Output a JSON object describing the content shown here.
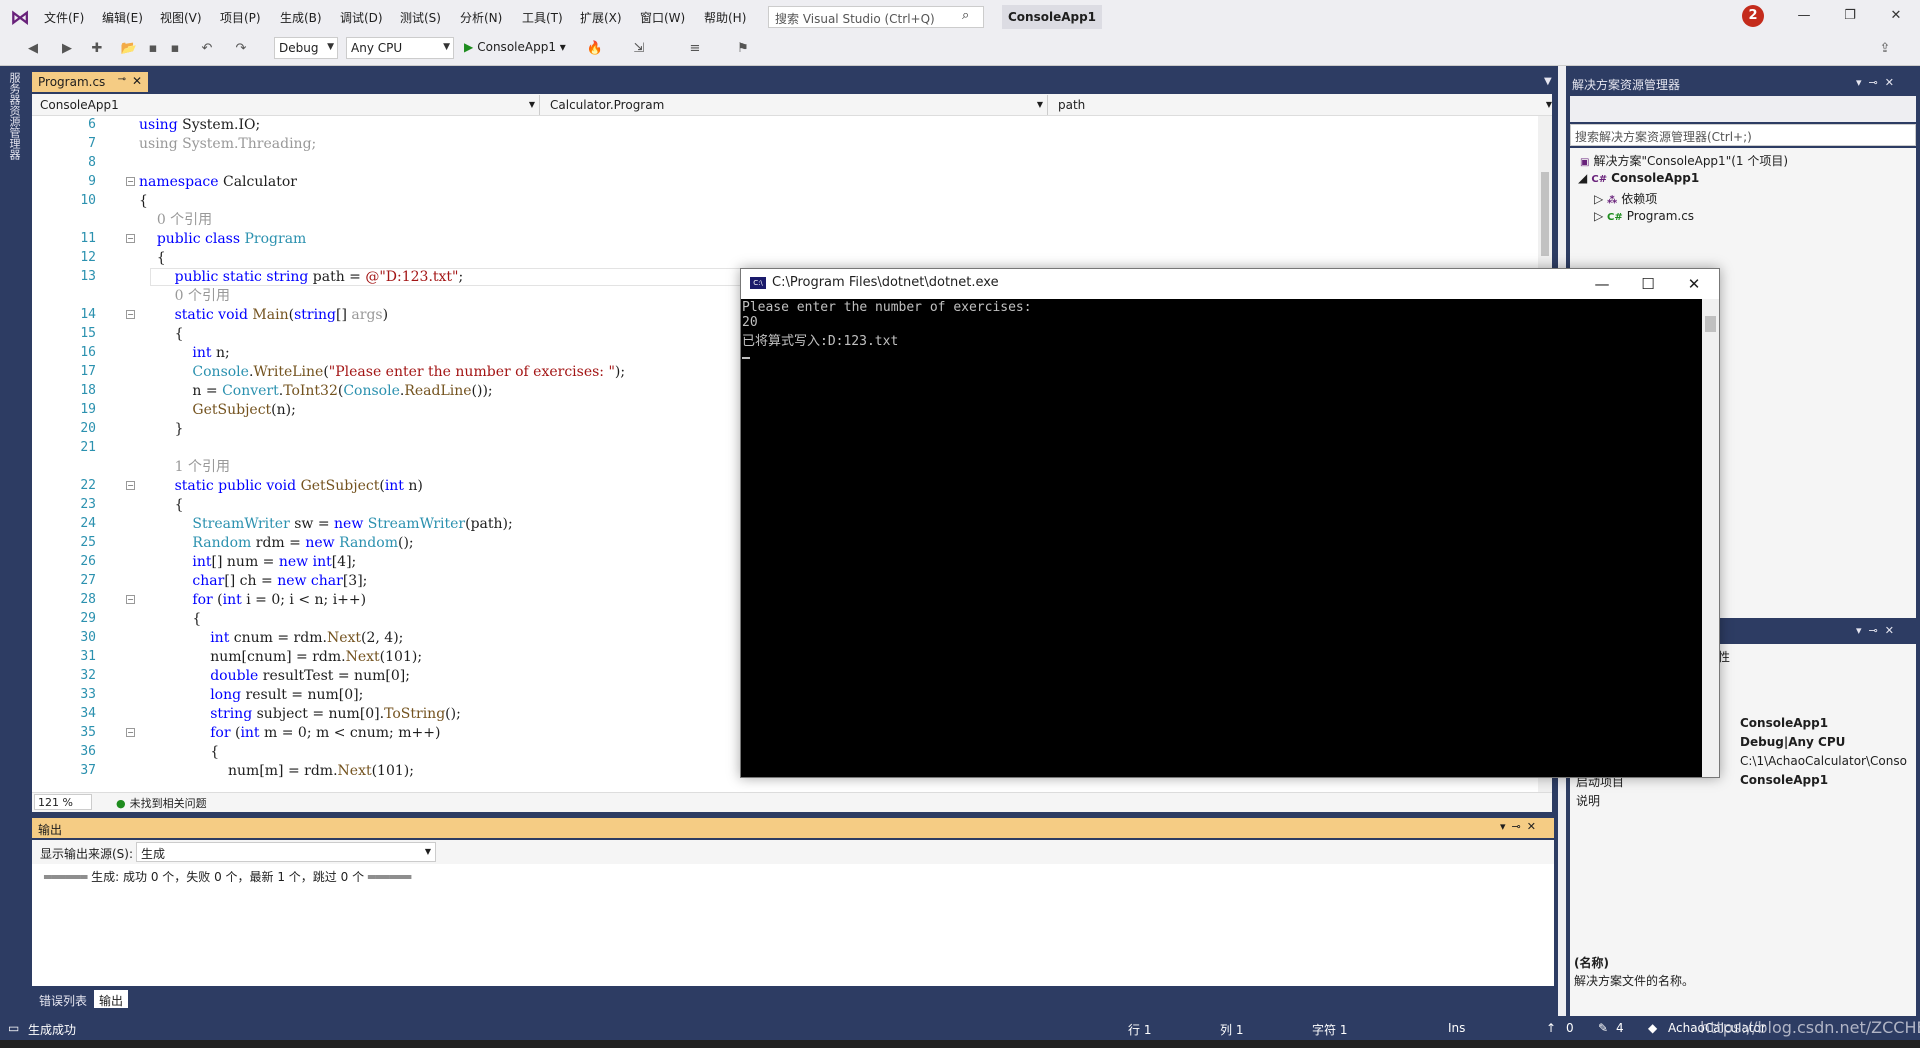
{
  "menu": [
    "文件(F)",
    "编辑(E)",
    "视图(V)",
    "项目(P)",
    "生成(B)",
    "调试(D)",
    "测试(S)",
    "分析(N)",
    "工具(T)",
    "扩展(X)",
    "窗口(W)",
    "帮助(H)"
  ],
  "search": {
    "placeholder": "搜索 Visual Studio (Ctrl+Q)"
  },
  "solution_title": "ConsoleApp1",
  "notification_count": "2",
  "toolbar": {
    "config": "Debug",
    "platform": "Any CPU",
    "start_label": "ConsoleApp1"
  },
  "left_rail_label": "服务器资源管理器",
  "document_tab": "Program.cs",
  "navbar": {
    "project": "ConsoleApp1",
    "class": "Calculator.Program",
    "member": "path"
  },
  "code_lines": [
    {
      "n": "6",
      "html": "<span class='kw'>using</span> System.IO;"
    },
    {
      "n": "7",
      "html": "<span class='gr'>using System.Threading;</span>"
    },
    {
      "n": "8",
      "html": ""
    },
    {
      "n": "9",
      "html": "<span class='kw'>namespace</span> Calculator"
    },
    {
      "n": "10",
      "html": "{"
    },
    {
      "n": "",
      "html": "    <span class='gr'>0 个引用</span>"
    },
    {
      "n": "11",
      "html": "    <span class='kw'>public class</span> <span class='ty'>Program</span>"
    },
    {
      "n": "12",
      "html": "    {"
    },
    {
      "n": "13",
      "html": "        <span class='kw'>public static string</span> path = <span class='st'>@\"D:123.txt\"</span>;"
    },
    {
      "n": "",
      "html": "        <span class='gr'>0 个引用</span>"
    },
    {
      "n": "14",
      "html": "        <span class='kw'>static void</span> <span class='mt'>Main</span>(<span class='kw'>string</span>[] <span class='gr'>args</span>)"
    },
    {
      "n": "15",
      "html": "        {"
    },
    {
      "n": "16",
      "html": "            <span class='kw'>int</span> n;"
    },
    {
      "n": "17",
      "html": "            <span class='ty'>Console</span>.<span class='mt'>WriteLine</span>(<span class='st'>\"Please enter the number of exercises: \"</span>);"
    },
    {
      "n": "18",
      "html": "            n = <span class='ty'>Convert</span>.<span class='mt'>ToInt32</span>(<span class='ty'>Console</span>.<span class='mt'>ReadLine</span>());"
    },
    {
      "n": "19",
      "html": "            <span class='mt'>GetSubject</span>(n);"
    },
    {
      "n": "20",
      "html": "        }"
    },
    {
      "n": "21",
      "html": ""
    },
    {
      "n": "",
      "html": "        <span class='gr'>1 个引用</span>"
    },
    {
      "n": "22",
      "html": "        <span class='kw'>static public void</span> <span class='mt'>GetSubject</span>(<span class='kw'>int</span> n)"
    },
    {
      "n": "23",
      "html": "        {"
    },
    {
      "n": "24",
      "html": "            <span class='ty'>StreamWriter</span> sw = <span class='kw'>new</span> <span class='ty'>StreamWriter</span>(path);"
    },
    {
      "n": "25",
      "html": "            <span class='ty'>Random</span> rdm = <span class='kw'>new</span> <span class='ty'>Random</span>();"
    },
    {
      "n": "26",
      "html": "            <span class='kw'>int</span>[] num = <span class='kw'>new int</span>[4];"
    },
    {
      "n": "27",
      "html": "            <span class='kw'>char</span>[] ch = <span class='kw'>new char</span>[3];"
    },
    {
      "n": "28",
      "html": "            <span class='kw'>for</span> (<span class='kw'>int</span> i = 0; i &lt; n; i++)"
    },
    {
      "n": "29",
      "html": "            {"
    },
    {
      "n": "30",
      "html": "                <span class='kw'>int</span> cnum = rdm.<span class='mt'>Next</span>(2, 4);"
    },
    {
      "n": "31",
      "html": "                num[cnum] = rdm.<span class='mt'>Next</span>(101);"
    },
    {
      "n": "32",
      "html": "                <span class='kw'>double</span> resultTest = num[0];"
    },
    {
      "n": "33",
      "html": "                <span class='kw'>long</span> result = num[0];"
    },
    {
      "n": "34",
      "html": "                <span class='kw'>string</span> subject = num[0].<span class='mt'>ToString</span>();"
    },
    {
      "n": "35",
      "html": "                <span class='kw'>for</span> (<span class='kw'>int</span> m = 0; m &lt; cnum; m++)"
    },
    {
      "n": "36",
      "html": "                {"
    },
    {
      "n": "37",
      "html": "                    num[m] = rdm.<span class='mt'>Next</span>(101);"
    }
  ],
  "editor_status": {
    "zoom": "121 %",
    "issues": "未找到相关问题"
  },
  "output": {
    "title": "输出",
    "source_label": "显示输出来源(S):",
    "source": "生成",
    "line": "══════ 生成: 成功 0 个，失败 0 个，最新 1 个，跳过 0 个 ══════"
  },
  "bottom_tabs": [
    "错误列表",
    "输出"
  ],
  "solution_explorer": {
    "title": "解决方案资源管理器",
    "search_placeholder": "搜索解决方案资源管理器(Ctrl+;)",
    "tree": [
      "解决方案\"ConsoleApp1\"(1 个项目)",
      "ConsoleApp1",
      "依赖项",
      "Program.cs"
    ]
  },
  "properties": {
    "title_partial": "性",
    "rows": [
      {
        "name": "",
        "value": "ConsoleApp1"
      },
      {
        "name": "",
        "value": "Debug|Any CPU"
      },
      {
        "name": "",
        "value": "C:\\1\\AchaoCalculator\\Conso"
      },
      {
        "name": "启动项目",
        "value": "ConsoleApp1"
      },
      {
        "name": "说明",
        "value": ""
      }
    ],
    "desc_name": "(名称)",
    "desc_text": "解决方案文件的名称。"
  },
  "statusbar": {
    "left": "生成成功",
    "row": "行 1",
    "col": "列 1",
    "char": "字符 1",
    "mode": "Ins",
    "up": "0",
    "pen": "4",
    "repo": "AchaoCalculator"
  },
  "watermark": "https://blog.csdn.net/ZCCHEN",
  "console": {
    "title": "C:\\Program Files\\dotnet\\dotnet.exe",
    "lines": [
      "Please enter the number of exercises:",
      "20",
      "已将算式写入:D:123.txt"
    ]
  }
}
